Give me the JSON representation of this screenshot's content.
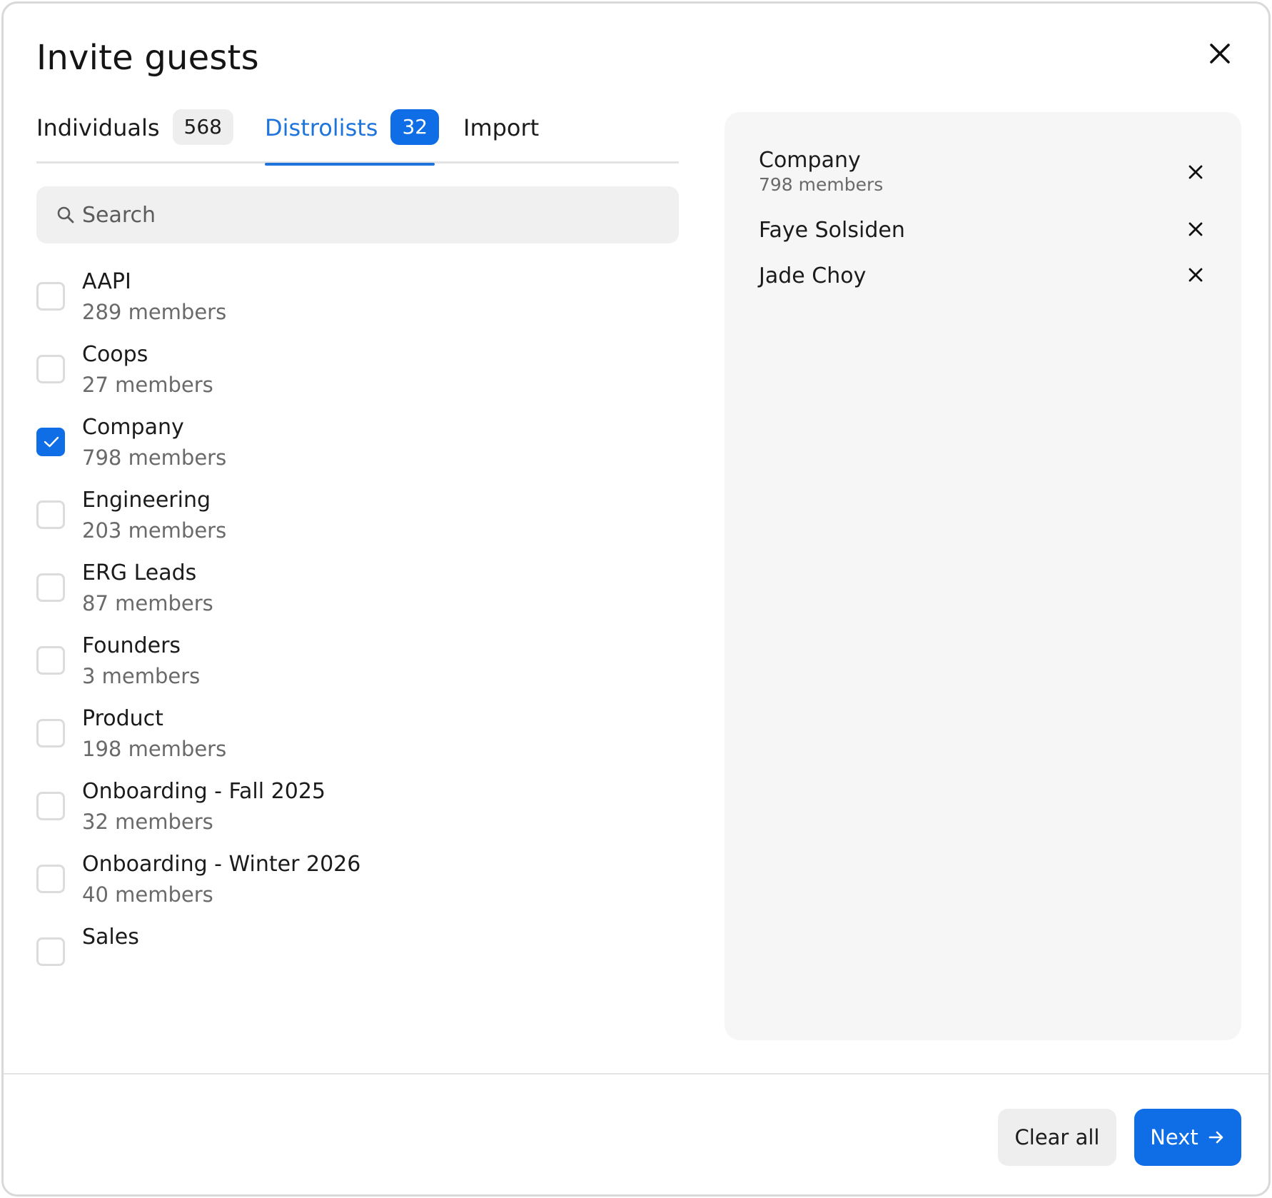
{
  "dialog": {
    "title": "Invite guests"
  },
  "tabs": [
    {
      "label": "Individuals",
      "badge": "568",
      "active": false
    },
    {
      "label": "Distrolists",
      "badge": "32",
      "active": true
    },
    {
      "label": "Import",
      "active": false
    }
  ],
  "search": {
    "placeholder": "Search",
    "value": ""
  },
  "distrolists": [
    {
      "name": "AAPI",
      "count": "289 members",
      "checked": false
    },
    {
      "name": "Coops",
      "count": "27 members",
      "checked": false
    },
    {
      "name": "Company",
      "count": "798 members",
      "checked": true
    },
    {
      "name": "Engineering",
      "count": "203 members",
      "checked": false
    },
    {
      "name": "ERG Leads",
      "count": "87 members",
      "checked": false
    },
    {
      "name": "Founders",
      "count": "3 members",
      "checked": false
    },
    {
      "name": "Product",
      "count": "198 members",
      "checked": false
    },
    {
      "name": "Onboarding - Fall 2025",
      "count": "32 members",
      "checked": false
    },
    {
      "name": "Onboarding - Winter 2026",
      "count": "40 members",
      "checked": false
    },
    {
      "name": "Sales",
      "checked": false
    }
  ],
  "selected": [
    {
      "name": "Company",
      "sub": "798 members"
    },
    {
      "name": "Faye Solsiden"
    },
    {
      "name": "Jade Choy"
    }
  ],
  "footer": {
    "clear_label": "Clear all",
    "next_label": "Next"
  },
  "colors": {
    "accent": "#0f6ee6",
    "tab_active_text": "#1f74db",
    "panel_bg": "#f6f6f6"
  },
  "icons": {
    "close": "close-icon",
    "search": "search-icon",
    "remove": "x-icon",
    "check": "check-icon",
    "next": "arrow-right-icon"
  }
}
